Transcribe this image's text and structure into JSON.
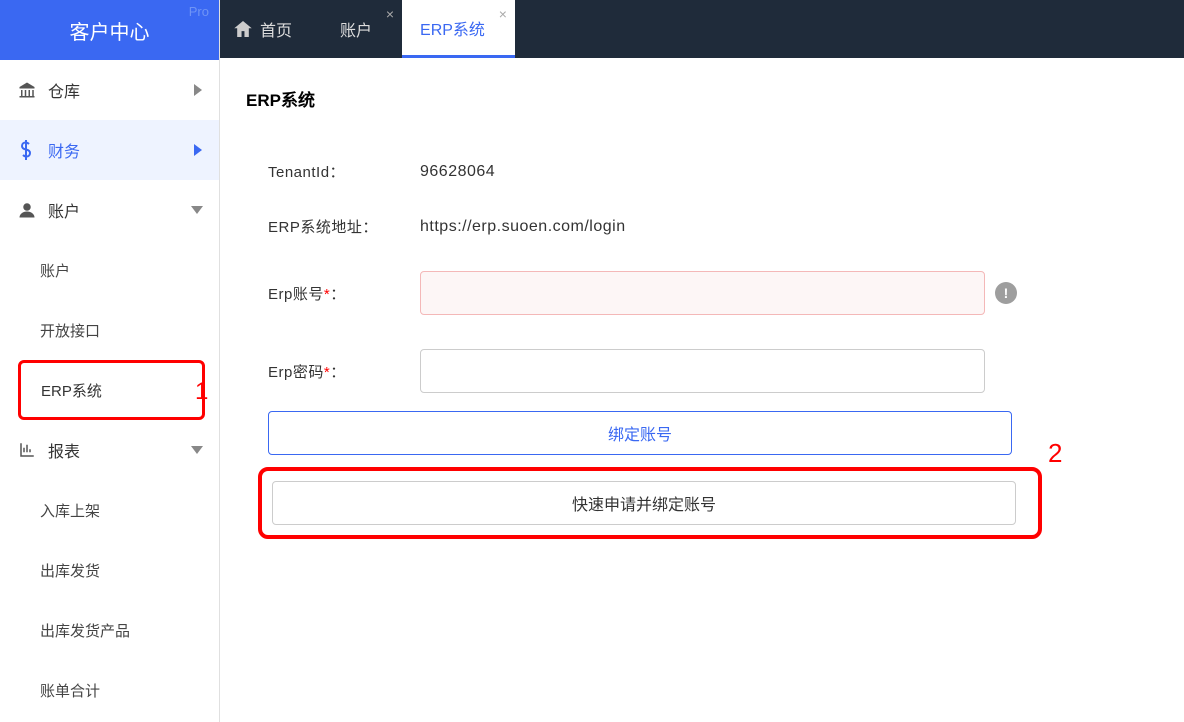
{
  "sidebar": {
    "title": "客户中心",
    "pro": "Pro",
    "items": [
      {
        "label": "仓库",
        "icon": "bank-icon"
      },
      {
        "label": "财务",
        "icon": "dollar-icon"
      },
      {
        "label": "账户",
        "icon": "user-icon"
      },
      {
        "label": "报表",
        "icon": "chart-icon"
      }
    ],
    "sub_account": [
      "账户",
      "开放接口",
      "ERP系统"
    ],
    "sub_report": [
      "入库上架",
      "出库发货",
      "出库发货产品",
      "账单合计"
    ]
  },
  "tabs": [
    {
      "label": "首页"
    },
    {
      "label": "账户"
    },
    {
      "label": "ERP系统"
    }
  ],
  "page": {
    "title": "ERP系统",
    "tenant_label": "TenantId：",
    "tenant_value": "96628064",
    "url_label": "ERP系统地址：",
    "url_value": "https://erp.suoen.com/login",
    "account_label": "Erp账号",
    "account_colon": "：",
    "password_label": "Erp密码",
    "password_colon": "：",
    "btn_bind": "绑定账号",
    "btn_quick": "快速申请并绑定账号",
    "req_mark": "*"
  },
  "annotations": {
    "one": "1",
    "two": "2"
  }
}
